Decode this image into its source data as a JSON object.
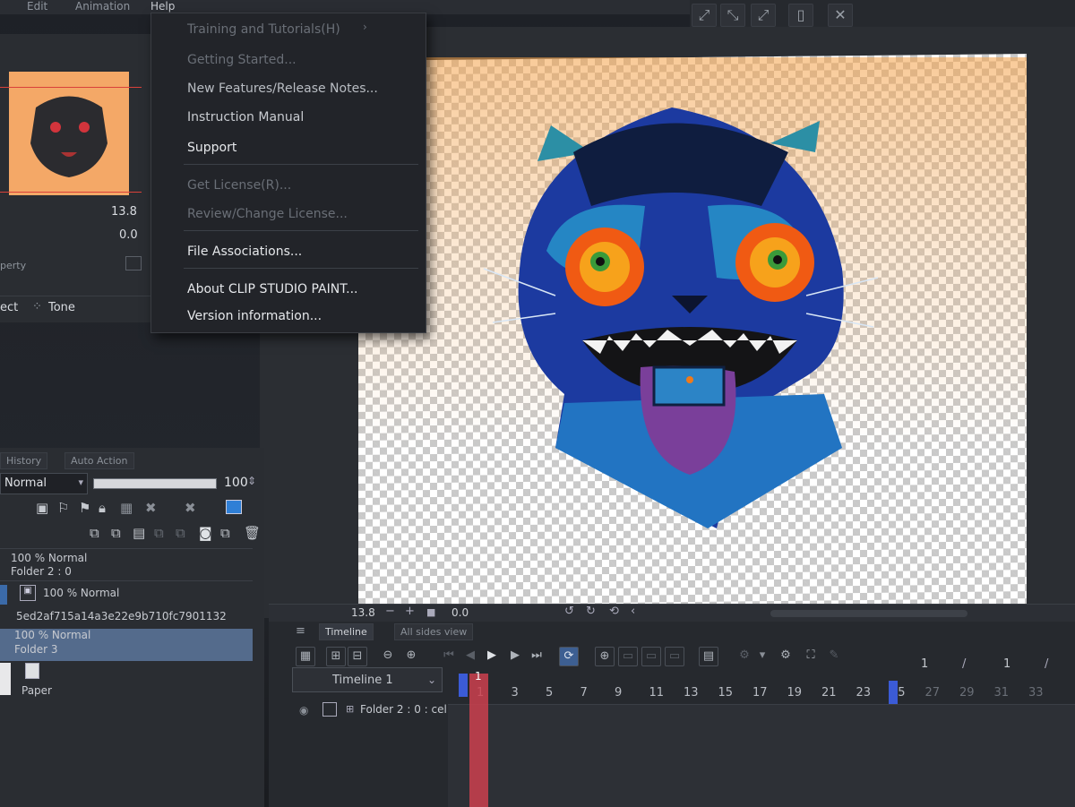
{
  "menubar": {
    "items": [
      "Edit",
      "Animation",
      "Help"
    ]
  },
  "help_menu": {
    "items": [
      {
        "label": "Training and Tutorials(H)",
        "enabled": false
      },
      {
        "label": "Getting Started...",
        "enabled": false
      },
      {
        "label": "New Features/Release Notes...",
        "enabled": true
      },
      {
        "label": "Instruction Manual",
        "enabled": true
      },
      {
        "label": "Support",
        "enabled": true
      },
      {
        "label": "Get License(R)...",
        "enabled": false
      },
      {
        "label": "Review/Change License...",
        "enabled": false
      },
      {
        "label": "File Associations...",
        "enabled": true
      },
      {
        "label": "About CLIP STUDIO PAINT...",
        "enabled": true
      },
      {
        "label": "Version information...",
        "enabled": true
      }
    ]
  },
  "navigator": {
    "zoom": "13.8",
    "rotation": "0.0",
    "property_label": "perty",
    "effect_label": "ect",
    "tone_label": "Tone"
  },
  "layer_panel": {
    "tabs": [
      "History",
      "Auto Action"
    ],
    "blend_mode": "Normal",
    "opacity": "100",
    "layers": [
      {
        "mode": "100 % Normal",
        "name": "Folder 2 : 0",
        "selected": false
      },
      {
        "mode": "100 % Normal",
        "name": "5ed2af715a14a3e22e9b710fc7901132",
        "selected": false
      },
      {
        "mode": "100 % Normal",
        "name": "Folder 3",
        "selected": true
      },
      {
        "mode": "",
        "name": "Paper",
        "selected": false
      }
    ]
  },
  "status_bar": {
    "zoom": "13.8",
    "rotation": "0.0"
  },
  "timeline": {
    "tabs": [
      "Timeline",
      "All sides view"
    ],
    "selected_timeline": "Timeline 1",
    "track_name": "Folder 2 : 0 : cel",
    "frame_counter_left": "1",
    "frame_counter_right": "1",
    "frames": [
      "1",
      "3",
      "5",
      "7",
      "9",
      "11",
      "13",
      "15",
      "17",
      "19",
      "21",
      "23",
      "25",
      "27",
      "29",
      "31",
      "33"
    ]
  },
  "colors": {
    "accent": "#546b8c",
    "canvas_tint": "#f4a867",
    "playhead": "#cd404e",
    "marker": "#3b5bd6"
  }
}
